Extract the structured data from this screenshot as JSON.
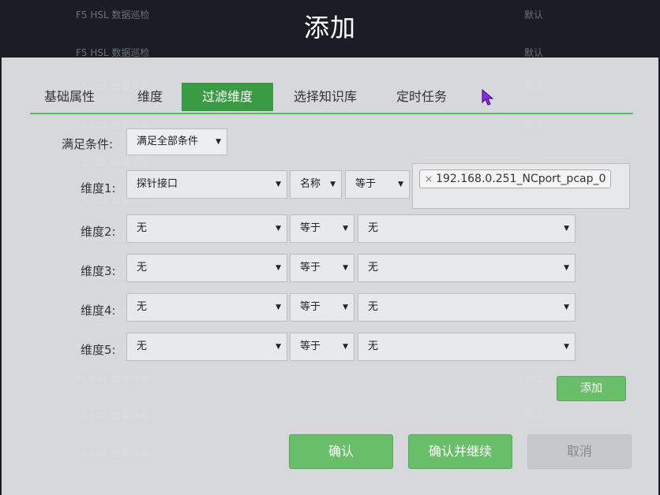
{
  "background_list": {
    "name": "F5 HSL 数据巡检",
    "status": "默认",
    "row_count": 13
  },
  "dialog": {
    "title": "添加",
    "tabs": [
      {
        "label": "基础属性",
        "active": false
      },
      {
        "label": "维度",
        "active": false
      },
      {
        "label": "过滤维度",
        "active": true
      },
      {
        "label": "选择知识库",
        "active": false
      },
      {
        "label": "定时任务",
        "active": false
      }
    ],
    "condition": {
      "label": "满足条件:",
      "value": "满足全部条件"
    },
    "dimensions": [
      {
        "label": "维度1:",
        "field": "探针接口",
        "attr": "名称",
        "operator": "等于",
        "value_tag": "192.168.0.251_NCport_pcap_0"
      },
      {
        "label": "维度2:",
        "field": "无",
        "operator": "等于",
        "value": "无"
      },
      {
        "label": "维度3:",
        "field": "无",
        "operator": "等于",
        "value": "无"
      },
      {
        "label": "维度4:",
        "field": "无",
        "operator": "等于",
        "value": "无"
      },
      {
        "label": "维度5:",
        "field": "无",
        "operator": "等于",
        "value": "无"
      }
    ],
    "add_button": "添加",
    "footer": {
      "confirm": "确认",
      "confirm_continue": "确认并继续",
      "cancel": "取消"
    },
    "tag_remove_glyph": "×"
  },
  "colors": {
    "accent_green": "#3a9b45",
    "button_green": "#69bf69",
    "cancel_gray": "#c6c8cb"
  }
}
